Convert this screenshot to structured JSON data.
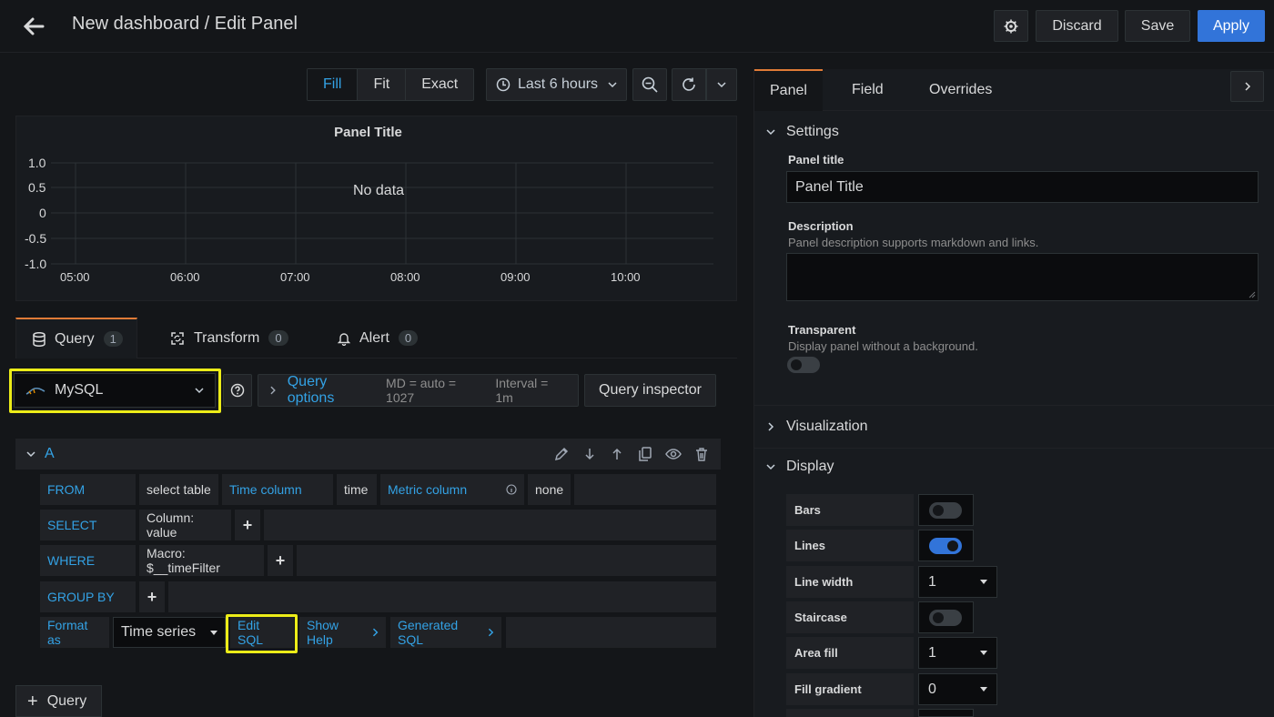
{
  "header": {
    "title": "New dashboard / Edit Panel",
    "discard_label": "Discard",
    "save_label": "Save",
    "apply_label": "Apply"
  },
  "view_modes": [
    "Fill",
    "Fit",
    "Exact"
  ],
  "view_mode_selected": "Fill",
  "time_picker": {
    "label": "Last 6 hours"
  },
  "panel_preview": {
    "title": "Panel Title",
    "no_data": "No data",
    "y_ticks": [
      "1.0",
      "0.5",
      "0",
      "-0.5",
      "-1.0"
    ],
    "x_ticks": [
      "05:00",
      "06:00",
      "07:00",
      "08:00",
      "09:00",
      "10:00"
    ]
  },
  "query_tabs": [
    {
      "label": "Query",
      "count": "1"
    },
    {
      "label": "Transform",
      "count": "0"
    },
    {
      "label": "Alert",
      "count": "0"
    }
  ],
  "datasource": {
    "name": "MySQL"
  },
  "query_options": {
    "label": "Query options",
    "md": "MD = auto = 1027",
    "interval": "Interval = 1m"
  },
  "query_inspector_label": "Query inspector",
  "query_a": {
    "letter": "A",
    "from_label": "FROM",
    "table": "select table",
    "time_column_label": "Time column",
    "time_column_value": "time",
    "metric_column_label": "Metric column",
    "metric_column_value": "none",
    "select_label": "SELECT",
    "select_value": "Column: value",
    "where_label": "WHERE",
    "where_value": "Macro: $__timeFilter",
    "group_by_label": "GROUP BY",
    "format_as_label": "Format as",
    "format_value": "Time series",
    "edit_sql": "Edit SQL",
    "show_help": "Show Help",
    "generated_sql": "Generated SQL"
  },
  "add_query_label": "Query",
  "options_tabs": [
    "Panel",
    "Field",
    "Overrides"
  ],
  "settings": {
    "header": "Settings",
    "panel_title_label": "Panel title",
    "panel_title_value": "Panel Title",
    "description_label": "Description",
    "description_hint": "Panel description supports markdown and links.",
    "transparent_label": "Transparent",
    "transparent_hint": "Display panel without a background."
  },
  "visualization_header": "Visualization",
  "display": {
    "header": "Display",
    "bars_label": "Bars",
    "lines_label": "Lines",
    "line_width_label": "Line width",
    "line_width_value": "1",
    "staircase_label": "Staircase",
    "area_fill_label": "Area fill",
    "area_fill_value": "1",
    "fill_gradient_label": "Fill gradient",
    "fill_gradient_value": "0"
  },
  "colors": {
    "accent_blue": "#33a2e5",
    "primary_button": "#3274d9",
    "tab_active_border": "#e07b37",
    "highlight": "#ecec18"
  }
}
